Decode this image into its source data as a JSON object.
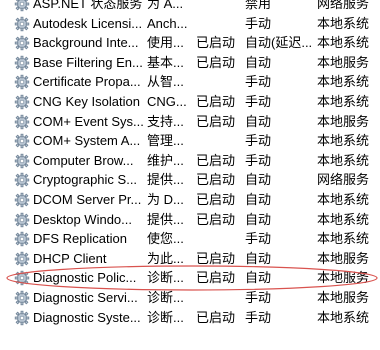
{
  "services": [
    {
      "name": "ASP.NET 状态服务",
      "description": "为 A...",
      "status": "",
      "startup": "禁用",
      "logon": "网络服务"
    },
    {
      "name": "Autodesk Licensi...",
      "description": "Anch...",
      "status": "",
      "startup": "手动",
      "logon": "本地系统"
    },
    {
      "name": "Background Inte...",
      "description": "使用...",
      "status": "已启动",
      "startup": "自动(延迟...",
      "logon": "本地系统"
    },
    {
      "name": "Base Filtering En...",
      "description": "基本...",
      "status": "已启动",
      "startup": "自动",
      "logon": "本地服务"
    },
    {
      "name": "Certificate Propa...",
      "description": "从智...",
      "status": "",
      "startup": "手动",
      "logon": "本地系统"
    },
    {
      "name": "CNG Key Isolation",
      "description": "CNG...",
      "status": "已启动",
      "startup": "手动",
      "logon": "本地系统"
    },
    {
      "name": "COM+ Event Sys...",
      "description": "支持...",
      "status": "已启动",
      "startup": "自动",
      "logon": "本地服务"
    },
    {
      "name": "COM+ System A...",
      "description": "管理...",
      "status": "",
      "startup": "手动",
      "logon": "本地系统"
    },
    {
      "name": "Computer Brow...",
      "description": "维护...",
      "status": "已启动",
      "startup": "手动",
      "logon": "本地系统"
    },
    {
      "name": "Cryptographic S...",
      "description": "提供...",
      "status": "已启动",
      "startup": "自动",
      "logon": "网络服务"
    },
    {
      "name": "DCOM Server Pr...",
      "description": "为 D...",
      "status": "已启动",
      "startup": "自动",
      "logon": "本地系统"
    },
    {
      "name": "Desktop Windo...",
      "description": "提供...",
      "status": "已启动",
      "startup": "自动",
      "logon": "本地系统"
    },
    {
      "name": "DFS Replication",
      "description": "使您...",
      "status": "",
      "startup": "手动",
      "logon": "本地系统"
    },
    {
      "name": "DHCP Client",
      "description": "为此...",
      "status": "已启动",
      "startup": "自动",
      "logon": "本地服务"
    },
    {
      "name": "Diagnostic Polic...",
      "description": "诊断...",
      "status": "已启动",
      "startup": "自动",
      "logon": "本地服务"
    },
    {
      "name": "Diagnostic Servi...",
      "description": "诊断...",
      "status": "",
      "startup": "手动",
      "logon": "本地服务"
    },
    {
      "name": "Diagnostic Syste...",
      "description": "诊断...",
      "status": "已启动",
      "startup": "手动",
      "logon": "本地系统"
    }
  ],
  "icon": "gear-icon",
  "colors": {
    "highlight_ellipse": "#d9534f",
    "gear_fill": "#b9c6d3",
    "gear_stroke": "#6f8296"
  }
}
